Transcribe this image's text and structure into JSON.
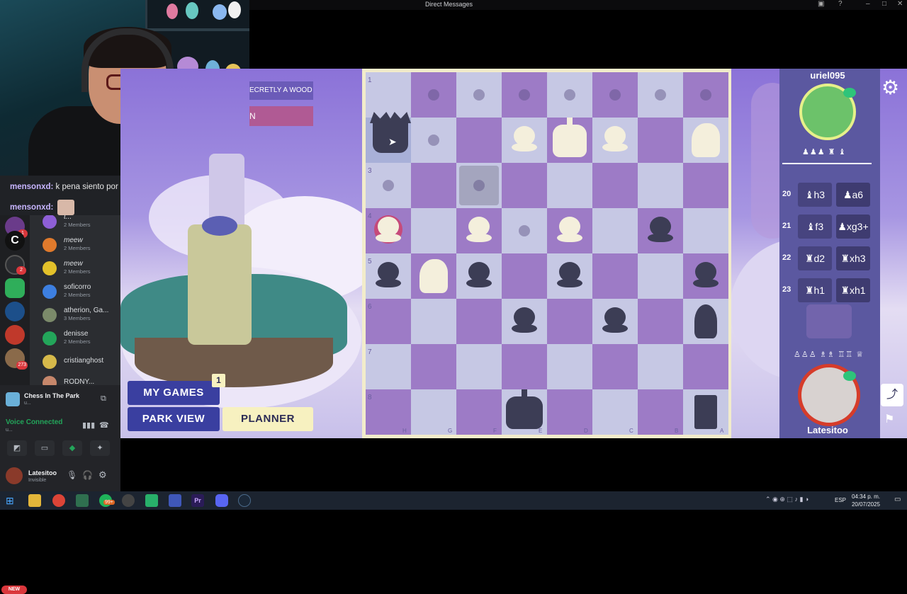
{
  "window": {
    "title": "Direct Messages"
  },
  "chat": {
    "lines": [
      {
        "user": "mensonxd:",
        "text": "k pena siento por sus padres"
      },
      {
        "user": "mensonxd:",
        "text": ""
      }
    ]
  },
  "servers": {
    "badges": [
      "1",
      "2",
      "273"
    ],
    "new_label": "NEW"
  },
  "dm_list": [
    {
      "name": "t...",
      "sub": "2 Members",
      "color": "#8e5fd6"
    },
    {
      "name": "meew",
      "sub": "2 Members",
      "color": "#e07a2c"
    },
    {
      "name": "meew",
      "sub": "2 Members",
      "color": "#e3c12a"
    },
    {
      "name": "soficorro",
      "sub": "2 Members",
      "color": "#3d7fe0"
    },
    {
      "name": "atherion, Ga...",
      "sub": "3 Members",
      "color": "#7b8a6a"
    },
    {
      "name": "denisse",
      "sub": "2 Members",
      "color": "#23a55a"
    },
    {
      "name": "cristianghost",
      "sub": "",
      "color": "#d6b94a"
    },
    {
      "name": "RODNY...",
      "sub": "",
      "color": "#c6876b"
    }
  ],
  "activity": {
    "name": "Chess In The Park",
    "sub": "u..."
  },
  "voice": {
    "status": "Voice Connected",
    "sub": "u..."
  },
  "user_panel": {
    "name": "Latesitoo",
    "status": "Invisible"
  },
  "game": {
    "secret_text": "ECRETLY A WOOD",
    "secret_text2": "N",
    "my_games": "MY GAMES",
    "my_games_badge": "1",
    "park_view": "PARK VIEW",
    "planner": "PLANNER",
    "ranks": [
      "1",
      "3",
      "4",
      "5",
      "6",
      "7",
      "8"
    ],
    "files": [
      "H",
      "G",
      "F",
      "E",
      "D",
      "C",
      "B",
      "A"
    ],
    "opponent": "uriel095",
    "player": "Latesitoo",
    "opponent_captured": "♟♟♟ ♜ ♝",
    "player_captured": "♙♙♙ ♗♗ ♖♖ ♕",
    "moves": [
      {
        "n": "20",
        "w": "♝h3",
        "b": "♟a6"
      },
      {
        "n": "21",
        "w": "♝f3",
        "b": "♟xg3+"
      },
      {
        "n": "22",
        "w": "♜d2",
        "b": "♜xh3"
      },
      {
        "n": "23",
        "w": "♜h1",
        "b": "♜xh1"
      }
    ],
    "settings_icon": "⚙",
    "share_icon": "⤴",
    "flag_icon": "⚑"
  },
  "taskbar": {
    "lang": "ESP",
    "time": "04:34 p. m.",
    "date": "20/07/2025",
    "discord_badge": "99+"
  }
}
